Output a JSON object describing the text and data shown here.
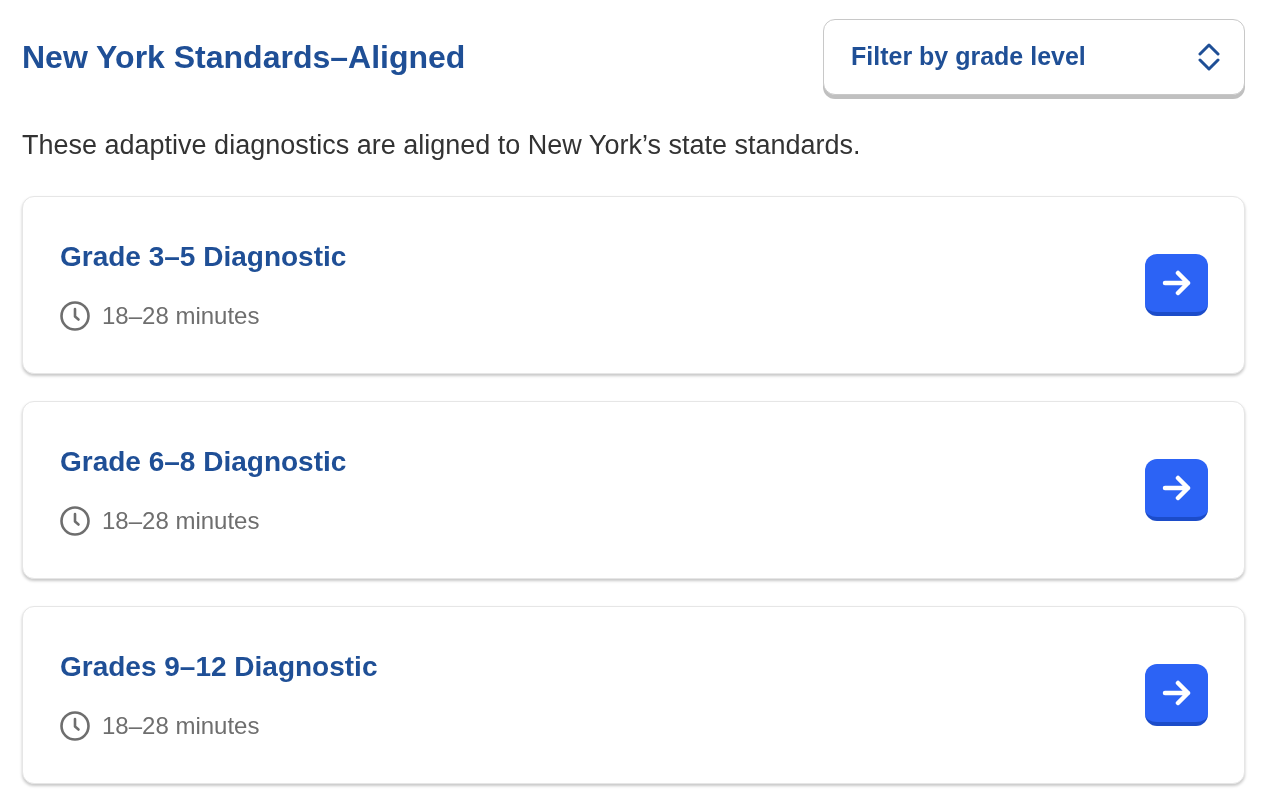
{
  "header": {
    "title": "New York Standards–Aligned",
    "filter": {
      "label": "Filter by grade level"
    }
  },
  "description": "These adaptive diagnostics are aligned to New York’s state standards.",
  "diagnostics": [
    {
      "title": "Grade 3–5 Diagnostic",
      "duration": "18–28 minutes"
    },
    {
      "title": "Grade 6–8 Diagnostic",
      "duration": "18–28 minutes"
    },
    {
      "title": "Grades 9–12 Diagnostic",
      "duration": "18–28 minutes"
    }
  ]
}
